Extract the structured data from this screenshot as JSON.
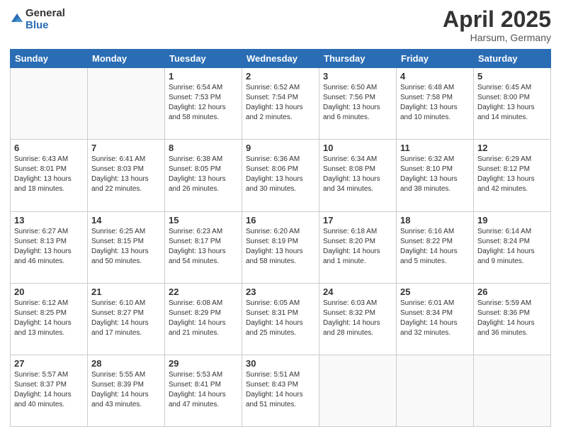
{
  "header": {
    "logo_line1": "General",
    "logo_line2": "Blue",
    "month": "April 2025",
    "location": "Harsum, Germany"
  },
  "days_of_week": [
    "Sunday",
    "Monday",
    "Tuesday",
    "Wednesday",
    "Thursday",
    "Friday",
    "Saturday"
  ],
  "weeks": [
    [
      {
        "day": "",
        "info": ""
      },
      {
        "day": "",
        "info": ""
      },
      {
        "day": "1",
        "info": "Sunrise: 6:54 AM\nSunset: 7:53 PM\nDaylight: 12 hours\nand 58 minutes."
      },
      {
        "day": "2",
        "info": "Sunrise: 6:52 AM\nSunset: 7:54 PM\nDaylight: 13 hours\nand 2 minutes."
      },
      {
        "day": "3",
        "info": "Sunrise: 6:50 AM\nSunset: 7:56 PM\nDaylight: 13 hours\nand 6 minutes."
      },
      {
        "day": "4",
        "info": "Sunrise: 6:48 AM\nSunset: 7:58 PM\nDaylight: 13 hours\nand 10 minutes."
      },
      {
        "day": "5",
        "info": "Sunrise: 6:45 AM\nSunset: 8:00 PM\nDaylight: 13 hours\nand 14 minutes."
      }
    ],
    [
      {
        "day": "6",
        "info": "Sunrise: 6:43 AM\nSunset: 8:01 PM\nDaylight: 13 hours\nand 18 minutes."
      },
      {
        "day": "7",
        "info": "Sunrise: 6:41 AM\nSunset: 8:03 PM\nDaylight: 13 hours\nand 22 minutes."
      },
      {
        "day": "8",
        "info": "Sunrise: 6:38 AM\nSunset: 8:05 PM\nDaylight: 13 hours\nand 26 minutes."
      },
      {
        "day": "9",
        "info": "Sunrise: 6:36 AM\nSunset: 8:06 PM\nDaylight: 13 hours\nand 30 minutes."
      },
      {
        "day": "10",
        "info": "Sunrise: 6:34 AM\nSunset: 8:08 PM\nDaylight: 13 hours\nand 34 minutes."
      },
      {
        "day": "11",
        "info": "Sunrise: 6:32 AM\nSunset: 8:10 PM\nDaylight: 13 hours\nand 38 minutes."
      },
      {
        "day": "12",
        "info": "Sunrise: 6:29 AM\nSunset: 8:12 PM\nDaylight: 13 hours\nand 42 minutes."
      }
    ],
    [
      {
        "day": "13",
        "info": "Sunrise: 6:27 AM\nSunset: 8:13 PM\nDaylight: 13 hours\nand 46 minutes."
      },
      {
        "day": "14",
        "info": "Sunrise: 6:25 AM\nSunset: 8:15 PM\nDaylight: 13 hours\nand 50 minutes."
      },
      {
        "day": "15",
        "info": "Sunrise: 6:23 AM\nSunset: 8:17 PM\nDaylight: 13 hours\nand 54 minutes."
      },
      {
        "day": "16",
        "info": "Sunrise: 6:20 AM\nSunset: 8:19 PM\nDaylight: 13 hours\nand 58 minutes."
      },
      {
        "day": "17",
        "info": "Sunrise: 6:18 AM\nSunset: 8:20 PM\nDaylight: 14 hours\nand 1 minute."
      },
      {
        "day": "18",
        "info": "Sunrise: 6:16 AM\nSunset: 8:22 PM\nDaylight: 14 hours\nand 5 minutes."
      },
      {
        "day": "19",
        "info": "Sunrise: 6:14 AM\nSunset: 8:24 PM\nDaylight: 14 hours\nand 9 minutes."
      }
    ],
    [
      {
        "day": "20",
        "info": "Sunrise: 6:12 AM\nSunset: 8:25 PM\nDaylight: 14 hours\nand 13 minutes."
      },
      {
        "day": "21",
        "info": "Sunrise: 6:10 AM\nSunset: 8:27 PM\nDaylight: 14 hours\nand 17 minutes."
      },
      {
        "day": "22",
        "info": "Sunrise: 6:08 AM\nSunset: 8:29 PM\nDaylight: 14 hours\nand 21 minutes."
      },
      {
        "day": "23",
        "info": "Sunrise: 6:05 AM\nSunset: 8:31 PM\nDaylight: 14 hours\nand 25 minutes."
      },
      {
        "day": "24",
        "info": "Sunrise: 6:03 AM\nSunset: 8:32 PM\nDaylight: 14 hours\nand 28 minutes."
      },
      {
        "day": "25",
        "info": "Sunrise: 6:01 AM\nSunset: 8:34 PM\nDaylight: 14 hours\nand 32 minutes."
      },
      {
        "day": "26",
        "info": "Sunrise: 5:59 AM\nSunset: 8:36 PM\nDaylight: 14 hours\nand 36 minutes."
      }
    ],
    [
      {
        "day": "27",
        "info": "Sunrise: 5:57 AM\nSunset: 8:37 PM\nDaylight: 14 hours\nand 40 minutes."
      },
      {
        "day": "28",
        "info": "Sunrise: 5:55 AM\nSunset: 8:39 PM\nDaylight: 14 hours\nand 43 minutes."
      },
      {
        "day": "29",
        "info": "Sunrise: 5:53 AM\nSunset: 8:41 PM\nDaylight: 14 hours\nand 47 minutes."
      },
      {
        "day": "30",
        "info": "Sunrise: 5:51 AM\nSunset: 8:43 PM\nDaylight: 14 hours\nand 51 minutes."
      },
      {
        "day": "",
        "info": ""
      },
      {
        "day": "",
        "info": ""
      },
      {
        "day": "",
        "info": ""
      }
    ]
  ]
}
